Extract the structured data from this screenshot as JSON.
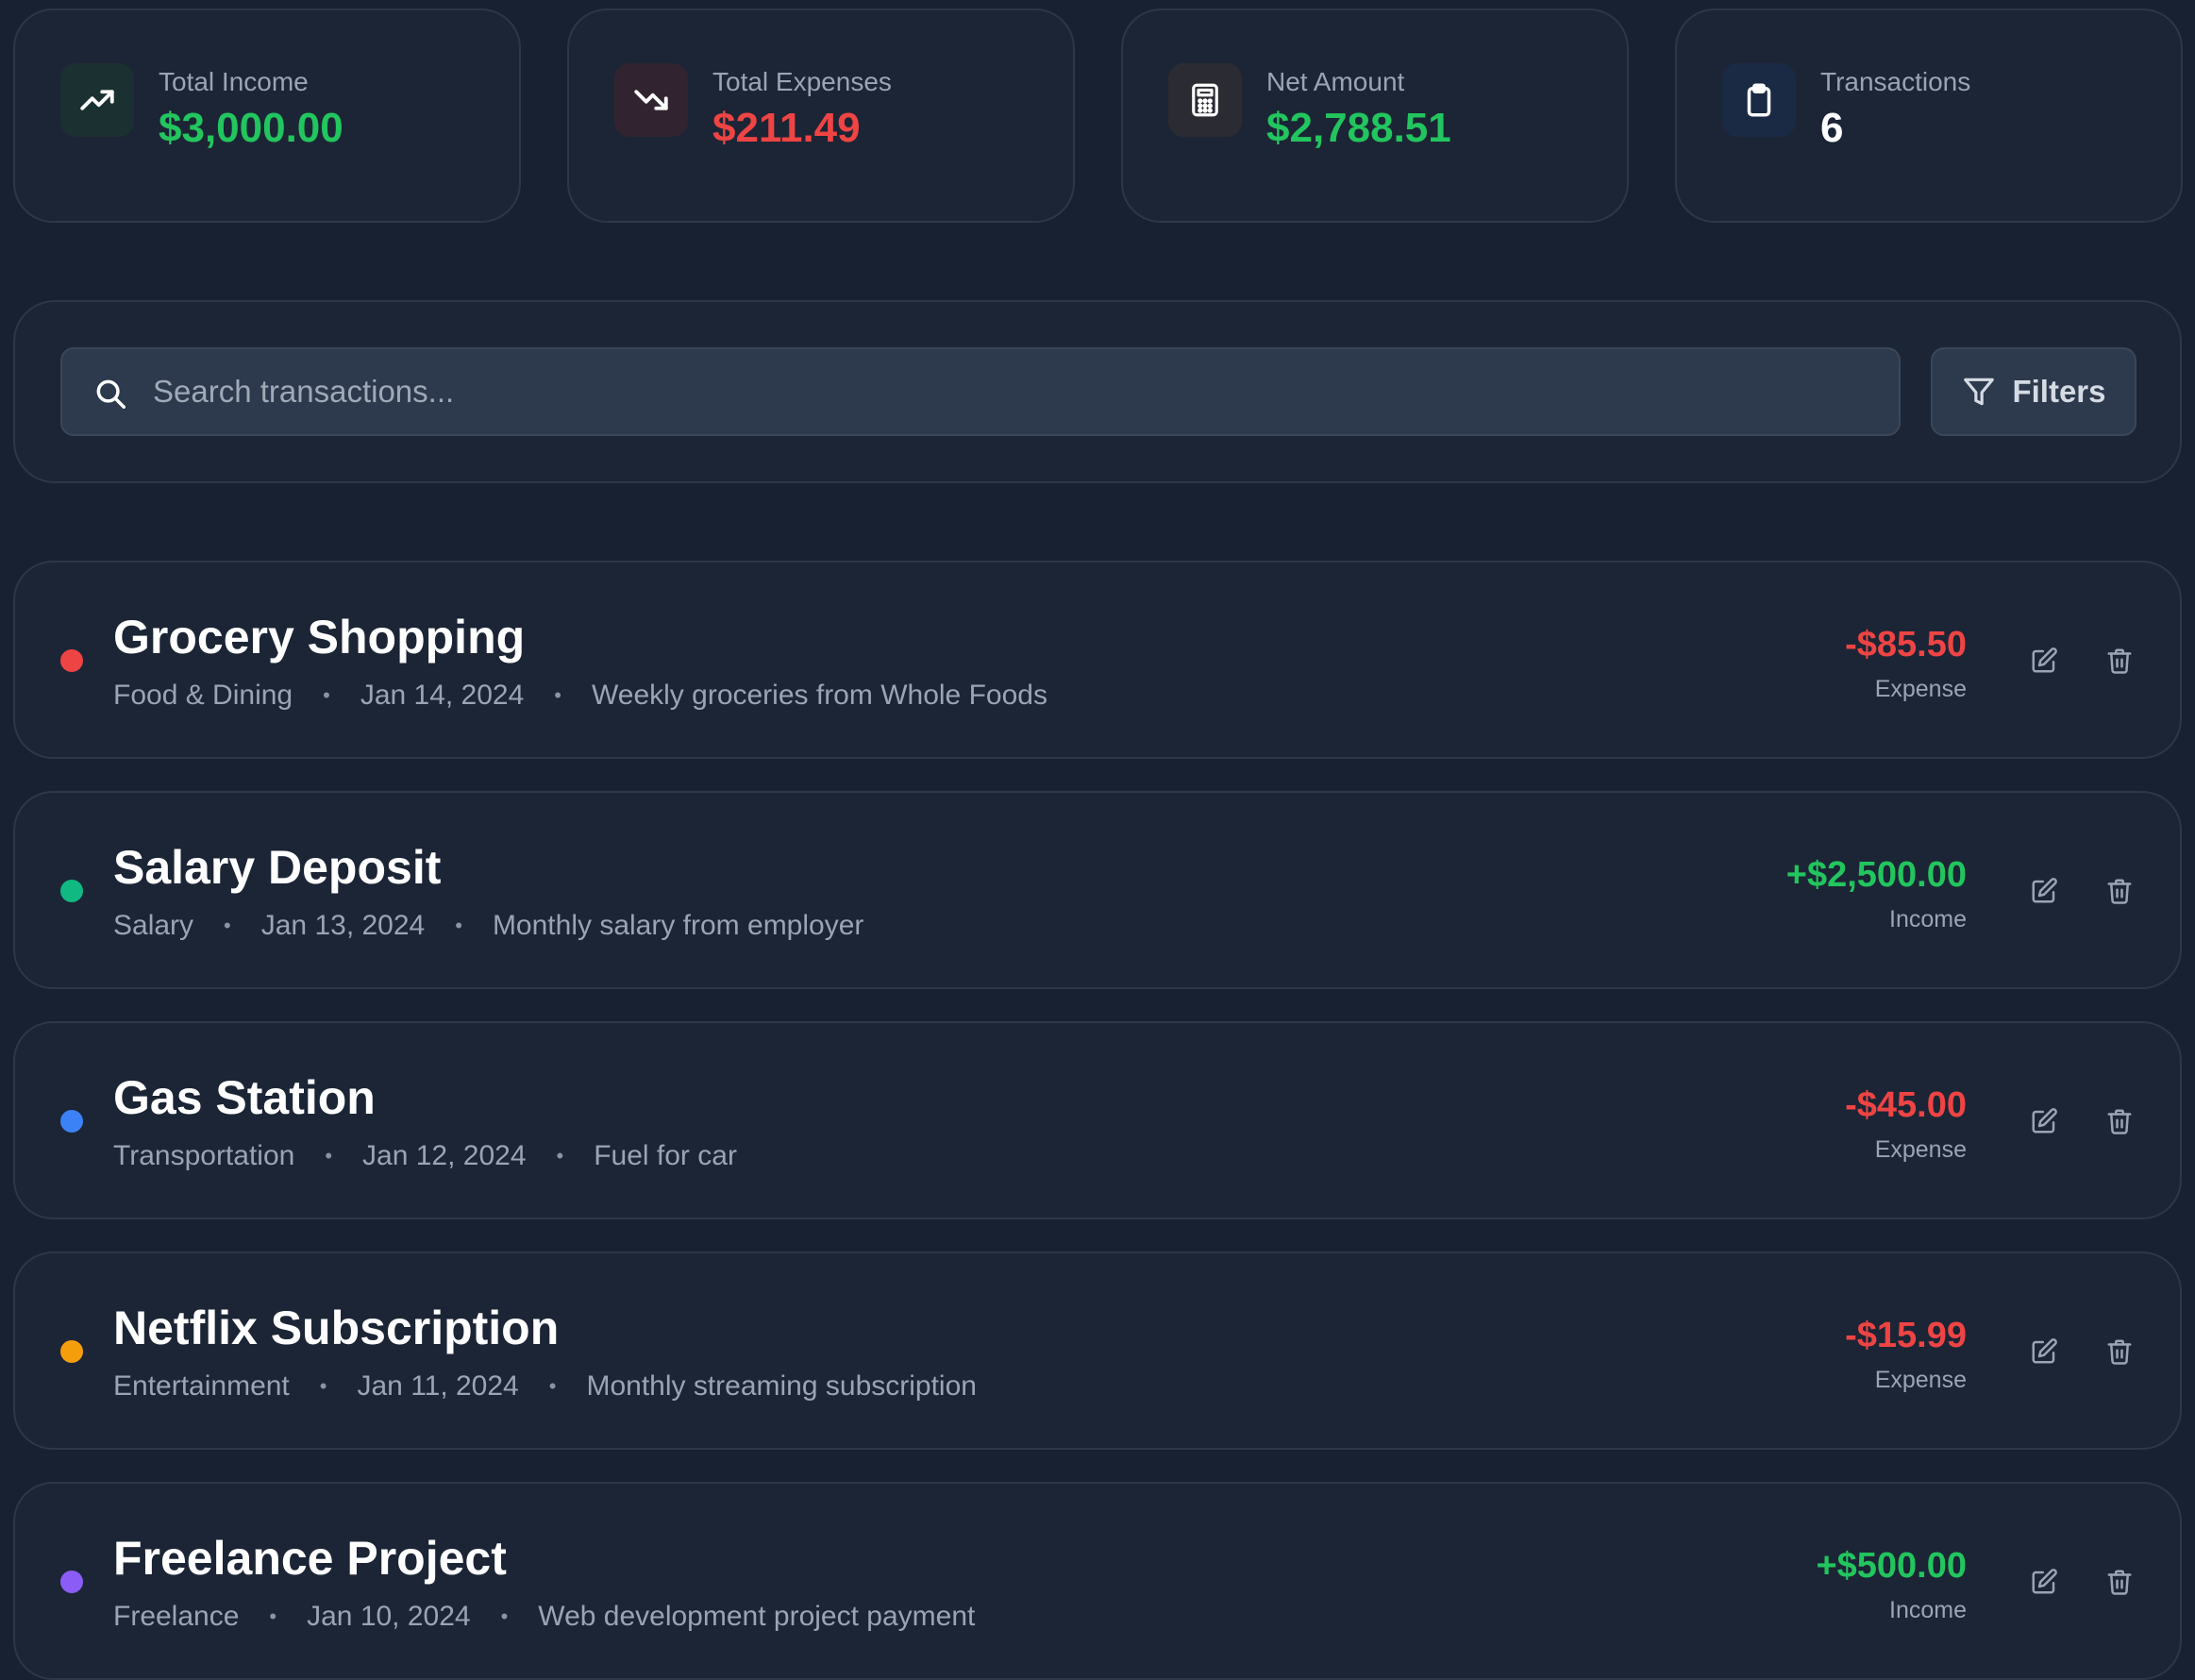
{
  "stats": [
    {
      "label": "Total Income",
      "value": "$3,000.00",
      "icon": "trending-up-icon",
      "color": "#22c55e",
      "icon_bg": "#1b3030"
    },
    {
      "label": "Total Expenses",
      "value": "$211.49",
      "icon": "trending-down-icon",
      "color": "#ef4444",
      "icon_bg": "#312430"
    },
    {
      "label": "Net Amount",
      "value": "$2,788.51",
      "icon": "calculator-icon",
      "color": "#22c55e",
      "icon_bg": "#2b2b33"
    },
    {
      "label": "Transactions",
      "value": "6",
      "icon": "clipboard-icon",
      "color": "#ffffff",
      "icon_bg": "#1a2a44"
    }
  ],
  "search": {
    "placeholder": "Search transactions...",
    "value": ""
  },
  "filters": {
    "label": "Filters"
  },
  "transactions": [
    {
      "title": "Grocery Shopping",
      "category": "Food & Dining",
      "date": "Jan 14, 2024",
      "note": "Weekly groceries from Whole Foods",
      "amount": "-$85.50",
      "type": "Expense",
      "dot_color": "#ef4444",
      "amount_color": "#ef4444"
    },
    {
      "title": "Salary Deposit",
      "category": "Salary",
      "date": "Jan 13, 2024",
      "note": "Monthly salary from employer",
      "amount": "+$2,500.00",
      "type": "Income",
      "dot_color": "#10b981",
      "amount_color": "#22c55e"
    },
    {
      "title": "Gas Station",
      "category": "Transportation",
      "date": "Jan 12, 2024",
      "note": "Fuel for car",
      "amount": "-$45.00",
      "type": "Expense",
      "dot_color": "#3b82f6",
      "amount_color": "#ef4444"
    },
    {
      "title": "Netflix Subscription",
      "category": "Entertainment",
      "date": "Jan 11, 2024",
      "note": "Monthly streaming subscription",
      "amount": "-$15.99",
      "type": "Expense",
      "dot_color": "#f59e0b",
      "amount_color": "#ef4444"
    },
    {
      "title": "Freelance Project",
      "category": "Freelance",
      "date": "Jan 10, 2024",
      "note": "Web development project payment",
      "amount": "+$500.00",
      "type": "Income",
      "dot_color": "#8b5cf6",
      "amount_color": "#22c55e"
    }
  ],
  "meta_separator": "•"
}
